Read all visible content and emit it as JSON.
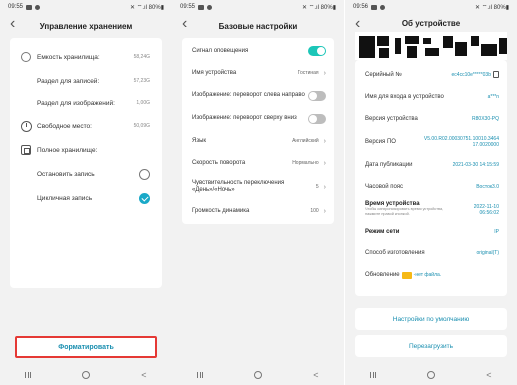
{
  "panel1": {
    "status_time": "09:55",
    "status_right": "✕ ⌔.ıl 80%▮",
    "title": "Управление хранением",
    "rows": [
      {
        "label": "Емкость хранилища:",
        "value": "58,24G"
      },
      {
        "label": "Раздел для записей:",
        "value": "57,23G"
      },
      {
        "label": "Раздел для изображений:",
        "value": "1,00G"
      },
      {
        "label": "Свободное место:",
        "value": "50,09G"
      },
      {
        "label": "Полное хранилище:",
        "value": ""
      },
      {
        "label": "Остановить запись",
        "value": ""
      },
      {
        "label": "Цикличная запись",
        "value": ""
      }
    ],
    "format_button": "Форматировать"
  },
  "panel2": {
    "status_time": "09:55",
    "status_right": "✕ ⌔.ıl 80%▮",
    "title": "Базовые настройки",
    "rows": [
      {
        "label": "Сигнал оповещения",
        "value": ""
      },
      {
        "label": "Имя устройства",
        "value": "Гостиная"
      },
      {
        "label": "Изображение: переворот слева направо",
        "value": ""
      },
      {
        "label": "Изображение: переворот сверху вниз",
        "value": ""
      },
      {
        "label": "Язык",
        "value": "Английский"
      },
      {
        "label": "Скорость поворота",
        "value": "Нормально"
      },
      {
        "label": "Чувствительность переключения «День»/«Ночь»",
        "value": "5"
      },
      {
        "label": "Громкость динамика",
        "value": "100"
      }
    ]
  },
  "panel3": {
    "status_time": "09:56",
    "status_right": "✕ ⌔.ıl 80%▮",
    "title": "Об устройстве",
    "rows": [
      {
        "label": "Серийный №",
        "value": "ec4cc10e*****03b"
      },
      {
        "label": "Имя для входа в устройство",
        "value": "a***n"
      },
      {
        "label": "Версия устройства",
        "value": "R80X30-PQ"
      },
      {
        "label": "Версия ПО",
        "value": "V5.00.R02.00030751.10010.3464 17.0020000"
      },
      {
        "label": "Дата публикации",
        "value": "2021-03-30 14:15:59"
      },
      {
        "label": "Часовой пояс",
        "value": "Восток3.0"
      },
      {
        "label": "Время устройства",
        "value": "2022-11-10 06:56:02"
      },
      {
        "label": "Режим сети",
        "value": "IP"
      },
      {
        "label": "Способ изготовления",
        "value": "original(T)"
      },
      {
        "label": "Обновление",
        "value": "-нет файла."
      }
    ],
    "time_note": "Чтобы синхронизировать время устройства, нажмите правой кнопкой.",
    "default_button": "Настройки по умолчанию",
    "reboot_button": "Перезагрузить"
  },
  "nav": {
    "back": "<"
  },
  "accent_color": "#1a8fb0",
  "toggle_color": "#1cc6b8"
}
